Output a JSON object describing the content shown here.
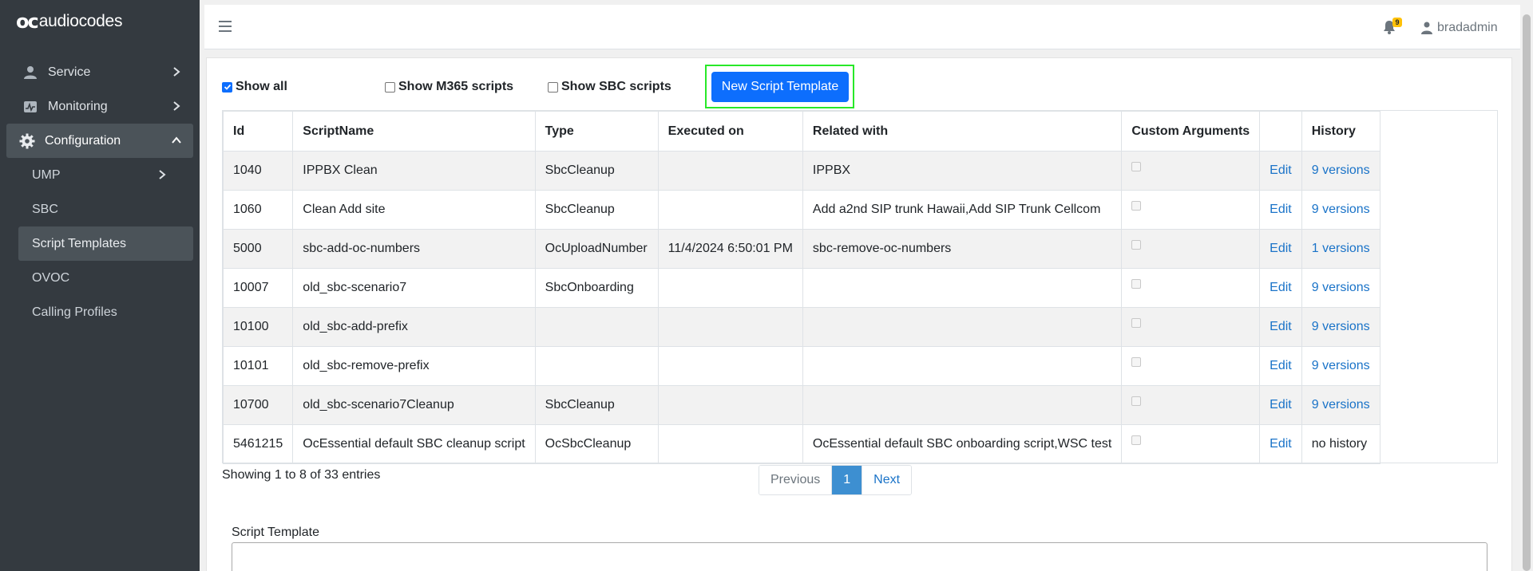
{
  "app": {
    "logo_mark": "oc",
    "logo_text": "audiocodes"
  },
  "sidebar": {
    "items": [
      {
        "label": "Service",
        "icon": "user-icon"
      },
      {
        "label": "Monitoring",
        "icon": "monitoring-icon"
      },
      {
        "label": "Configuration",
        "icon": "gear-icon"
      }
    ],
    "sub_items": [
      "UMP",
      "SBC",
      "Script Templates",
      "OVOC",
      "Calling Profiles"
    ]
  },
  "topbar": {
    "notification_count": "9",
    "username": "bradadmin"
  },
  "filters": {
    "show_all": "Show all",
    "show_m365": "Show M365 scripts",
    "show_sbc": "Show SBC scripts",
    "new_button": "New Script Template"
  },
  "table": {
    "headers": [
      "Id",
      "ScriptName",
      "Type",
      "Executed on",
      "Related with",
      "Custom Arguments",
      "",
      "History"
    ],
    "rows": [
      {
        "id": "1040",
        "name": "IPPBX Clean",
        "type": "SbcCleanup",
        "executed": "",
        "related": "IPPBX",
        "edit": "Edit",
        "history": "9 versions"
      },
      {
        "id": "1060",
        "name": "Clean Add site",
        "type": "SbcCleanup",
        "executed": "",
        "related": "Add a2nd SIP trunk Hawaii,Add SIP Trunk Cellcom",
        "edit": "Edit",
        "history": "9 versions"
      },
      {
        "id": "5000",
        "name": "sbc-add-oc-numbers",
        "type": "OcUploadNumber",
        "executed": "11/4/2024 6:50:01 PM",
        "related": "sbc-remove-oc-numbers",
        "edit": "Edit",
        "history": "1 versions"
      },
      {
        "id": "10007",
        "name": "old_sbc-scenario7",
        "type": "SbcOnboarding",
        "executed": "",
        "related": "",
        "edit": "Edit",
        "history": "9 versions"
      },
      {
        "id": "10100",
        "name": "old_sbc-add-prefix",
        "type": "",
        "executed": "",
        "related": "",
        "edit": "Edit",
        "history": "9 versions"
      },
      {
        "id": "10101",
        "name": "old_sbc-remove-prefix",
        "type": "",
        "executed": "",
        "related": "",
        "edit": "Edit",
        "history": "9 versions"
      },
      {
        "id": "10700",
        "name": "old_sbc-scenario7Cleanup",
        "type": "SbcCleanup",
        "executed": "",
        "related": "",
        "edit": "Edit",
        "history": "9 versions"
      },
      {
        "id": "5461215",
        "name": "OcEssential default SBC cleanup script",
        "type": "OcSbcCleanup",
        "executed": "",
        "related": "OcEssential default SBC onboarding script,WSC test",
        "edit": "Edit",
        "history": "no history"
      }
    ]
  },
  "pagination": {
    "showing": "Showing 1 to 8 of 33 entries",
    "previous": "Previous",
    "current": "1",
    "next": "Next"
  },
  "script_template": {
    "label": "Script Template"
  },
  "colors": {
    "sidebar_bg": "#343a40",
    "primary": "#0d6efd",
    "highlight_border": "#28e828",
    "badge": "#ffc107"
  }
}
